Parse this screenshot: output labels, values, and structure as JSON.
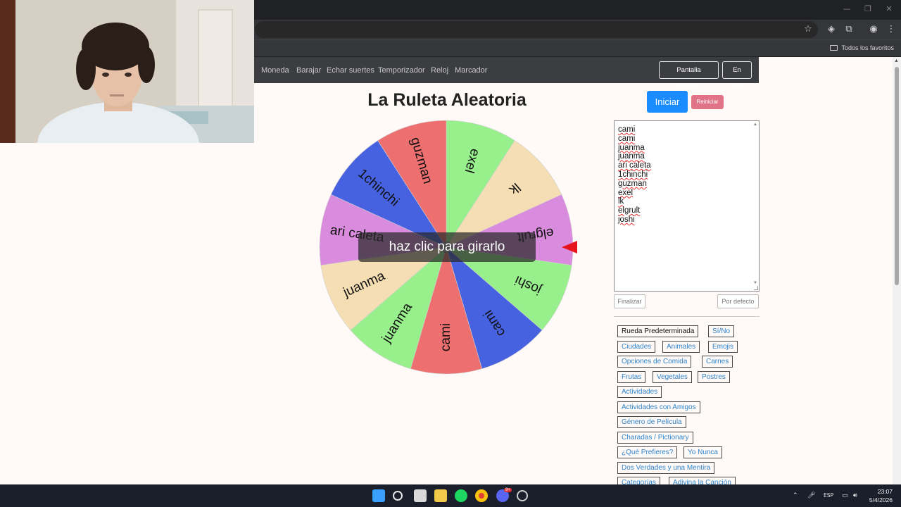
{
  "browser": {
    "bookmarks_all": "Todos los favoritos"
  },
  "navbar": {
    "links": [
      "Moneda",
      "Barajar",
      "Echar suertes",
      "Temporizador",
      "Reloj",
      "Marcador"
    ],
    "fullscreen_label": "Pantalla completa",
    "live_label": "En vivo"
  },
  "title": "La Ruleta Aleatoria",
  "buttons": {
    "start": "Iniciar",
    "reset": "Reiniciar",
    "finish": "Finalizar",
    "default": "Por defecto"
  },
  "wheel": {
    "overlay_text": "haz clic para girarlo",
    "segments": [
      {
        "label": "exel",
        "color": "#98f08c"
      },
      {
        "label": "lk",
        "color": "#f5deb3"
      },
      {
        "label": "elgrult",
        "color": "#d98cdd"
      },
      {
        "label": "joshi",
        "color": "#98f08c"
      },
      {
        "label": "cami",
        "color": "#4662e0"
      },
      {
        "label": "cami",
        "color": "#ee6f6f"
      },
      {
        "label": "juanma",
        "color": "#98f08c"
      },
      {
        "label": "juanma",
        "color": "#f5deb3"
      },
      {
        "label": "ari caleta",
        "color": "#d98cdd"
      },
      {
        "label": "1chinchi",
        "color": "#4662e0"
      },
      {
        "label": "guzman",
        "color": "#ee6f6f"
      }
    ]
  },
  "names": [
    "cami",
    "cami",
    "juanma",
    "juanma",
    "ari caleta",
    "1chinchi",
    "guzman",
    "exel",
    "lk",
    "elgrult",
    "joshi"
  ],
  "presets": [
    [
      "Rueda Predeterminada",
      "Sí/No"
    ],
    [
      "Ciudades",
      "Animales",
      "Emojis"
    ],
    [
      "Opciones de Comida",
      "Carnes"
    ],
    [
      "Frutas",
      "Vegetales",
      "Postres"
    ],
    [
      "Actividades"
    ],
    [
      "Actividades con Amigos"
    ],
    [
      "Género de Película"
    ],
    [
      "Charadas / Pictionary"
    ],
    [
      "¿Qué Prefieres?",
      "Yo Nunca"
    ],
    [
      "Dos Verdades y una Mentira"
    ],
    [
      "Categorías",
      "Adivina la Canción"
    ]
  ],
  "taskbar": {
    "language": "ESP",
    "time": "23:07",
    "date": "5/4/2026",
    "notification_badge": "9+"
  },
  "colors": {
    "accent": "#1a8cff",
    "reset": "#e07387",
    "pointer": "#e8141d",
    "navbar": "#3c3d40"
  }
}
